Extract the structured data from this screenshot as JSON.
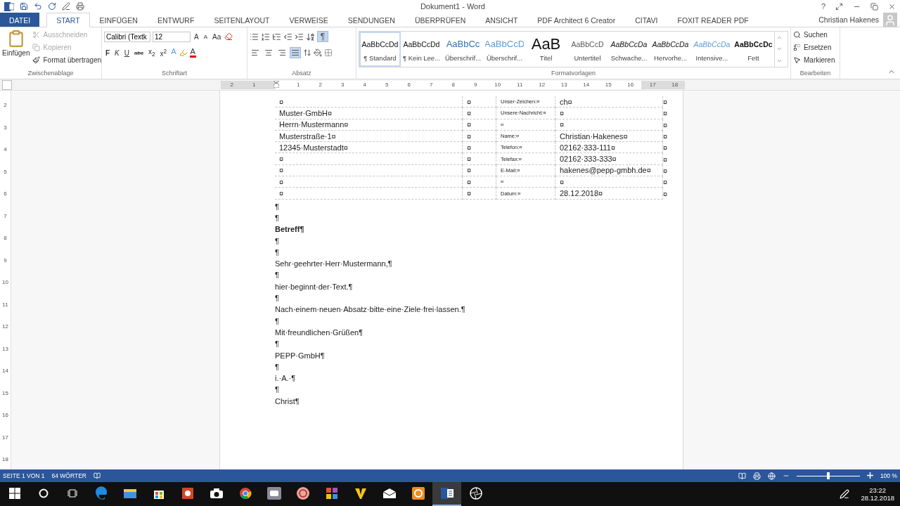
{
  "window": {
    "title": "Dokument1 - Word",
    "help": "?"
  },
  "tabs": [
    {
      "label": "DATEI",
      "kind": "file",
      "selected": false
    },
    {
      "label": "START",
      "kind": "tab",
      "selected": true
    },
    {
      "label": "EINFÜGEN",
      "kind": "tab",
      "selected": false
    },
    {
      "label": "ENTWURF",
      "kind": "tab",
      "selected": false
    },
    {
      "label": "SEITENLAYOUT",
      "kind": "tab",
      "selected": false
    },
    {
      "label": "VERWEISE",
      "kind": "tab",
      "selected": false
    },
    {
      "label": "SENDUNGEN",
      "kind": "tab",
      "selected": false
    },
    {
      "label": "ÜBERPRÜFEN",
      "kind": "tab",
      "selected": false
    },
    {
      "label": "ANSICHT",
      "kind": "tab",
      "selected": false
    },
    {
      "label": "PDF Architect 6 Creator",
      "kind": "tab",
      "selected": false
    },
    {
      "label": "CITAVI",
      "kind": "tab",
      "selected": false
    },
    {
      "label": "FOXIT READER PDF",
      "kind": "tab",
      "selected": false
    }
  ],
  "user": "Christian Hakenes",
  "clipboard": {
    "group": "Zwischenablage",
    "paste": "Einfügen",
    "items": [
      {
        "label": "Ausschneiden",
        "kind": "cut",
        "disabled": true
      },
      {
        "label": "Kopieren",
        "kind": "copy",
        "disabled": true
      },
      {
        "label": "Format übertragen",
        "kind": "brush",
        "disabled": false
      }
    ]
  },
  "font": {
    "group": "Schriftart",
    "family": "Calibri (Textk",
    "size": "12",
    "grow": "A",
    "shrink": "A",
    "case": "Aa",
    "formats": [
      {
        "label": "F",
        "kind": "bold"
      },
      {
        "label": "K",
        "kind": "italic"
      },
      {
        "label": "U",
        "kind": "underline"
      },
      {
        "label": "abc",
        "kind": "strike"
      },
      {
        "label": "x$_{2}$",
        "kind": "plain"
      },
      {
        "label": "x$^{2}$",
        "kind": "plain"
      }
    ],
    "effects": "A",
    "font_color_label": "A"
  },
  "paragraph": {
    "group": "Absatz",
    "show_marks": {
      "label": "¶",
      "selected": true
    },
    "alignments": [
      {
        "kind": "left",
        "selected": false
      },
      {
        "kind": "center",
        "selected": false
      },
      {
        "kind": "right",
        "selected": false
      },
      {
        "kind": "justify",
        "selected": true
      }
    ]
  },
  "styles": {
    "group": "Formatvorlagen",
    "items": [
      {
        "preview": "AaBbCcDd",
        "label": "¶ Standard",
        "kind": "normal",
        "selected": true
      },
      {
        "preview": "AaBbCcDd",
        "label": "¶ Kein Lee...",
        "kind": "normal",
        "selected": false
      },
      {
        "preview": "AaBbCc",
        "label": "Überschrif...",
        "kind": "heading1",
        "selected": false
      },
      {
        "preview": "AaBbCcD",
        "label": "Überschrif...",
        "kind": "heading2",
        "selected": false
      },
      {
        "preview": "AaB",
        "label": "Titel",
        "kind": "title",
        "selected": false
      },
      {
        "preview": "AaBbCcD",
        "label": "Untertitel",
        "kind": "subtitle",
        "selected": false
      },
      {
        "preview": "AaBbCcDa",
        "label": "Schwache...",
        "kind": "subtle",
        "selected": false
      },
      {
        "preview": "AaBbCcDa",
        "label": "Hervorhe...",
        "kind": "emphasis",
        "selected": false
      },
      {
        "preview": "AaBbCcDa",
        "label": "Intensive...",
        "kind": "intense",
        "selected": false
      },
      {
        "preview": "AaBbCcDc",
        "label": "Fett",
        "kind": "strong",
        "selected": false
      }
    ]
  },
  "editing": {
    "group": "Bearbeiten",
    "items": [
      {
        "label": "Suchen",
        "kind": "search"
      },
      {
        "label": "Ersetzen",
        "kind": "replace"
      },
      {
        "label": "Markieren",
        "kind": "select"
      }
    ]
  },
  "ruler": {
    "left_numbers": [
      "2",
      "1"
    ],
    "numbers": [
      "1",
      "2",
      "3",
      "4",
      "5",
      "6",
      "7",
      "8",
      "9",
      "10",
      "11",
      "12",
      "13",
      "14",
      "15",
      "16",
      "17",
      "18"
    ],
    "vertical_numbers": [
      "2",
      "3",
      "4",
      "5",
      "6",
      "7",
      "8",
      "9",
      "10",
      "11",
      "12",
      "13",
      "14",
      "15",
      "16",
      "17",
      "18"
    ]
  },
  "table": {
    "rows": [
      {
        "cells": [
          "¤",
          "¤",
          "Unser·Zeichen:¤",
          "ch¤"
        ],
        "end": "¤"
      },
      {
        "cells": [
          "Muster·GmbH¤",
          "¤",
          "Unsere·Nachricht:¤",
          "¤"
        ],
        "end": "¤"
      },
      {
        "cells": [
          "Herrn·Mustermann¤",
          "¤",
          "¤",
          "¤"
        ],
        "end": "¤"
      },
      {
        "cells": [
          "Musterstraße·1¤",
          "¤",
          "Name:¤",
          "Christian·Hakenes¤"
        ],
        "end": "¤"
      },
      {
        "cells": [
          "12345·Musterstadt¤",
          "¤",
          "Telefon:¤",
          "02162·333-111¤"
        ],
        "end": "¤"
      },
      {
        "cells": [
          "¤",
          "¤",
          "Telefax:¤",
          "02162·333-333¤"
        ],
        "end": "¤"
      },
      {
        "cells": [
          "¤",
          "¤",
          "E-Mail:¤",
          "hakenes@pepp-gmbh.de¤"
        ],
        "end": "¤"
      },
      {
        "cells": [
          "¤",
          "¤",
          "¤",
          "¤"
        ],
        "end": "¤"
      },
      {
        "cells": [
          "¤",
          "¤",
          "Datum:¤",
          "28.12.2018¤"
        ],
        "end": "¤"
      }
    ]
  },
  "paragraphs": [
    {
      "text": "¶",
      "bold": false
    },
    {
      "text": "¶",
      "bold": false
    },
    {
      "text": "Betreff¶",
      "bold": true
    },
    {
      "text": "¶",
      "bold": false
    },
    {
      "text": "¶",
      "bold": false
    },
    {
      "text": "Sehr·geehrter·Herr·Mustermann,¶",
      "bold": false
    },
    {
      "text": "¶",
      "bold": false
    },
    {
      "text": "hier·beginnt·der·Text.¶",
      "bold": false
    },
    {
      "text": "¶",
      "bold": false
    },
    {
      "text": "Nach·einem·neuen·Absatz·bitte·eine·Ziele·frei·lassen.¶",
      "bold": false
    },
    {
      "text": "¶",
      "bold": false
    },
    {
      "text": "Mit·freundlichen·Grüßen¶",
      "bold": false
    },
    {
      "text": "¶",
      "bold": false
    },
    {
      "text": "PEPP·GmbH¶",
      "bold": false
    },
    {
      "text": "¶",
      "bold": false
    },
    {
      "text": "i.·A.·¶",
      "bold": false
    },
    {
      "text": "¶",
      "bold": false
    },
    {
      "text": "Christ¶",
      "bold": false
    }
  ],
  "status_bar": {
    "page": "SEITE 1 VON 1",
    "words": "64 WÖRTER",
    "zoom": "100 %",
    "zoom_slider": {
      "level": 0.5
    }
  },
  "taskbar": {
    "apps": [
      {
        "kind": "cortana",
        "selected": false
      },
      {
        "kind": "taskview",
        "selected": false
      },
      {
        "kind": "edge",
        "selected": false
      },
      {
        "kind": "explorer",
        "selected": false
      },
      {
        "kind": "store",
        "selected": false
      },
      {
        "kind": "powerpoint",
        "selected": false
      },
      {
        "kind": "camera",
        "selected": false
      },
      {
        "kind": "chrome",
        "selected": false
      },
      {
        "kind": "video",
        "selected": false
      },
      {
        "kind": "ring",
        "selected": false
      },
      {
        "kind": "puzzle",
        "selected": false
      },
      {
        "kind": "vee",
        "selected": false
      },
      {
        "kind": "mail",
        "selected": false
      },
      {
        "kind": "ringsquare",
        "selected": false
      },
      {
        "kind": "word",
        "selected": true
      },
      {
        "kind": "aperture",
        "selected": false
      }
    ],
    "time": "23:22",
    "date": "28.12.2018"
  }
}
